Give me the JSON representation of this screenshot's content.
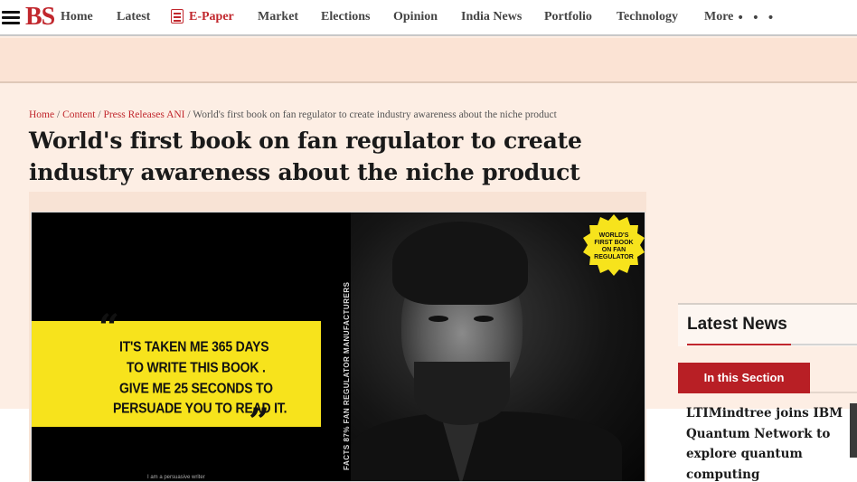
{
  "nav": {
    "logo": "BS",
    "items": [
      "Home",
      "Latest",
      "E-Paper",
      "Market",
      "Elections",
      "Opinion",
      "India News",
      "Portfolio",
      "Technology",
      "More"
    ],
    "more_dots": "• • •"
  },
  "breadcrumb": {
    "home": "Home",
    "content": "Content",
    "press": "Press Releases ANI",
    "current": "World's first book on fan regulator to create industry awareness about the niche product",
    "sep": " / "
  },
  "article": {
    "headline": "World's first book on fan regulator to create industry awareness about the niche product"
  },
  "hero": {
    "quote_open": "“",
    "quote_close": "”",
    "quote_lines": [
      "IT'S TAKEN ME 365 DAYS",
      "TO WRITE THIS BOOK .",
      "GIVE ME 25 SECONDS TO",
      "PERSUADE YOU TO READ IT."
    ],
    "tiny_text": "I am a persuasive writer",
    "vertical_text": "FACTS 87% FAN REGULATOR MANUFACTURERS",
    "badge_lines": [
      "WORLD'S",
      "FIRST BOOK",
      "ON FAN",
      "REGULATOR"
    ],
    "badge_color": "#f7e31c"
  },
  "sidebar": {
    "latest_title": "Latest News",
    "section_tab": "In this Section",
    "news_item": "LTIMindtree joins IBM Quantum Network to explore quantum computing"
  },
  "colors": {
    "brand_red": "#c1272d",
    "page_bg": "#fdeee4",
    "quote_yellow": "#f7e31c"
  }
}
